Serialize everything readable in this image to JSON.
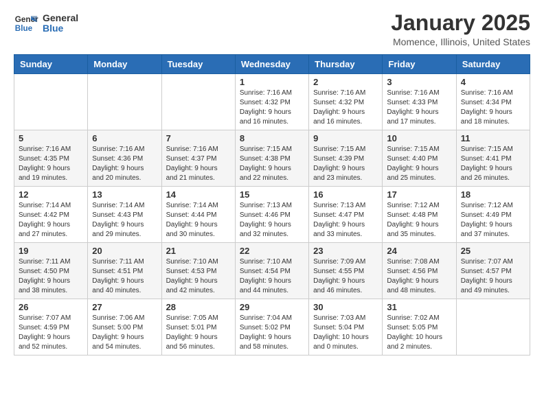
{
  "logo": {
    "text_general": "General",
    "text_blue": "Blue"
  },
  "header": {
    "title": "January 2025",
    "subtitle": "Momence, Illinois, United States"
  },
  "weekdays": [
    "Sunday",
    "Monday",
    "Tuesday",
    "Wednesday",
    "Thursday",
    "Friday",
    "Saturday"
  ],
  "weeks": [
    [
      {
        "day": "",
        "info": ""
      },
      {
        "day": "",
        "info": ""
      },
      {
        "day": "",
        "info": ""
      },
      {
        "day": "1",
        "info": "Sunrise: 7:16 AM\nSunset: 4:32 PM\nDaylight: 9 hours\nand 16 minutes."
      },
      {
        "day": "2",
        "info": "Sunrise: 7:16 AM\nSunset: 4:32 PM\nDaylight: 9 hours\nand 16 minutes."
      },
      {
        "day": "3",
        "info": "Sunrise: 7:16 AM\nSunset: 4:33 PM\nDaylight: 9 hours\nand 17 minutes."
      },
      {
        "day": "4",
        "info": "Sunrise: 7:16 AM\nSunset: 4:34 PM\nDaylight: 9 hours\nand 18 minutes."
      }
    ],
    [
      {
        "day": "5",
        "info": "Sunrise: 7:16 AM\nSunset: 4:35 PM\nDaylight: 9 hours\nand 19 minutes."
      },
      {
        "day": "6",
        "info": "Sunrise: 7:16 AM\nSunset: 4:36 PM\nDaylight: 9 hours\nand 20 minutes."
      },
      {
        "day": "7",
        "info": "Sunrise: 7:16 AM\nSunset: 4:37 PM\nDaylight: 9 hours\nand 21 minutes."
      },
      {
        "day": "8",
        "info": "Sunrise: 7:15 AM\nSunset: 4:38 PM\nDaylight: 9 hours\nand 22 minutes."
      },
      {
        "day": "9",
        "info": "Sunrise: 7:15 AM\nSunset: 4:39 PM\nDaylight: 9 hours\nand 23 minutes."
      },
      {
        "day": "10",
        "info": "Sunrise: 7:15 AM\nSunset: 4:40 PM\nDaylight: 9 hours\nand 25 minutes."
      },
      {
        "day": "11",
        "info": "Sunrise: 7:15 AM\nSunset: 4:41 PM\nDaylight: 9 hours\nand 26 minutes."
      }
    ],
    [
      {
        "day": "12",
        "info": "Sunrise: 7:14 AM\nSunset: 4:42 PM\nDaylight: 9 hours\nand 27 minutes."
      },
      {
        "day": "13",
        "info": "Sunrise: 7:14 AM\nSunset: 4:43 PM\nDaylight: 9 hours\nand 29 minutes."
      },
      {
        "day": "14",
        "info": "Sunrise: 7:14 AM\nSunset: 4:44 PM\nDaylight: 9 hours\nand 30 minutes."
      },
      {
        "day": "15",
        "info": "Sunrise: 7:13 AM\nSunset: 4:46 PM\nDaylight: 9 hours\nand 32 minutes."
      },
      {
        "day": "16",
        "info": "Sunrise: 7:13 AM\nSunset: 4:47 PM\nDaylight: 9 hours\nand 33 minutes."
      },
      {
        "day": "17",
        "info": "Sunrise: 7:12 AM\nSunset: 4:48 PM\nDaylight: 9 hours\nand 35 minutes."
      },
      {
        "day": "18",
        "info": "Sunrise: 7:12 AM\nSunset: 4:49 PM\nDaylight: 9 hours\nand 37 minutes."
      }
    ],
    [
      {
        "day": "19",
        "info": "Sunrise: 7:11 AM\nSunset: 4:50 PM\nDaylight: 9 hours\nand 38 minutes."
      },
      {
        "day": "20",
        "info": "Sunrise: 7:11 AM\nSunset: 4:51 PM\nDaylight: 9 hours\nand 40 minutes."
      },
      {
        "day": "21",
        "info": "Sunrise: 7:10 AM\nSunset: 4:53 PM\nDaylight: 9 hours\nand 42 minutes."
      },
      {
        "day": "22",
        "info": "Sunrise: 7:10 AM\nSunset: 4:54 PM\nDaylight: 9 hours\nand 44 minutes."
      },
      {
        "day": "23",
        "info": "Sunrise: 7:09 AM\nSunset: 4:55 PM\nDaylight: 9 hours\nand 46 minutes."
      },
      {
        "day": "24",
        "info": "Sunrise: 7:08 AM\nSunset: 4:56 PM\nDaylight: 9 hours\nand 48 minutes."
      },
      {
        "day": "25",
        "info": "Sunrise: 7:07 AM\nSunset: 4:57 PM\nDaylight: 9 hours\nand 49 minutes."
      }
    ],
    [
      {
        "day": "26",
        "info": "Sunrise: 7:07 AM\nSunset: 4:59 PM\nDaylight: 9 hours\nand 52 minutes."
      },
      {
        "day": "27",
        "info": "Sunrise: 7:06 AM\nSunset: 5:00 PM\nDaylight: 9 hours\nand 54 minutes."
      },
      {
        "day": "28",
        "info": "Sunrise: 7:05 AM\nSunset: 5:01 PM\nDaylight: 9 hours\nand 56 minutes."
      },
      {
        "day": "29",
        "info": "Sunrise: 7:04 AM\nSunset: 5:02 PM\nDaylight: 9 hours\nand 58 minutes."
      },
      {
        "day": "30",
        "info": "Sunrise: 7:03 AM\nSunset: 5:04 PM\nDaylight: 10 hours\nand 0 minutes."
      },
      {
        "day": "31",
        "info": "Sunrise: 7:02 AM\nSunset: 5:05 PM\nDaylight: 10 hours\nand 2 minutes."
      },
      {
        "day": "",
        "info": ""
      }
    ]
  ]
}
